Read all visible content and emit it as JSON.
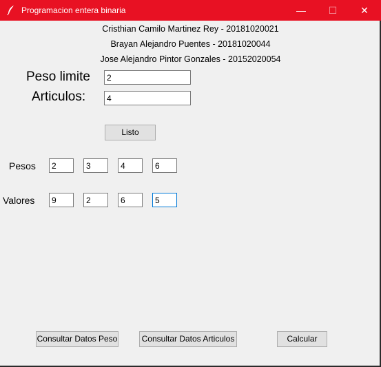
{
  "window": {
    "title": "Programacion entera binaria",
    "minimize_symbol": "—",
    "maximize_symbol": "☐",
    "close_symbol": "✕"
  },
  "authors": [
    "Cristhian Camilo Martinez Rey - 20181020021",
    "Brayan Alejandro Puentes - 20181020044",
    "Jose Alejandro Pintor Gonzales - 20152020054"
  ],
  "form": {
    "peso_limite_label": "Peso limite",
    "peso_limite_value": "2",
    "articulos_label": "Articulos:",
    "articulos_value": "4",
    "listo_label": "Listo"
  },
  "pesos": {
    "label": "Pesos",
    "values": [
      "2",
      "3",
      "4",
      "6"
    ]
  },
  "valores": {
    "label": "Valores",
    "values": [
      "9",
      "2",
      "6",
      "5"
    ]
  },
  "buttons": {
    "consultar_peso": "Consultar Datos Peso",
    "consultar_articulos": "Consultar Datos Articulos",
    "calcular": "Calcular"
  },
  "colors": {
    "titlebar": "#e81123",
    "window_bg": "#f0f0f0",
    "focus_border": "#0078d7"
  },
  "icons": {
    "app_icon": "feather-icon"
  }
}
